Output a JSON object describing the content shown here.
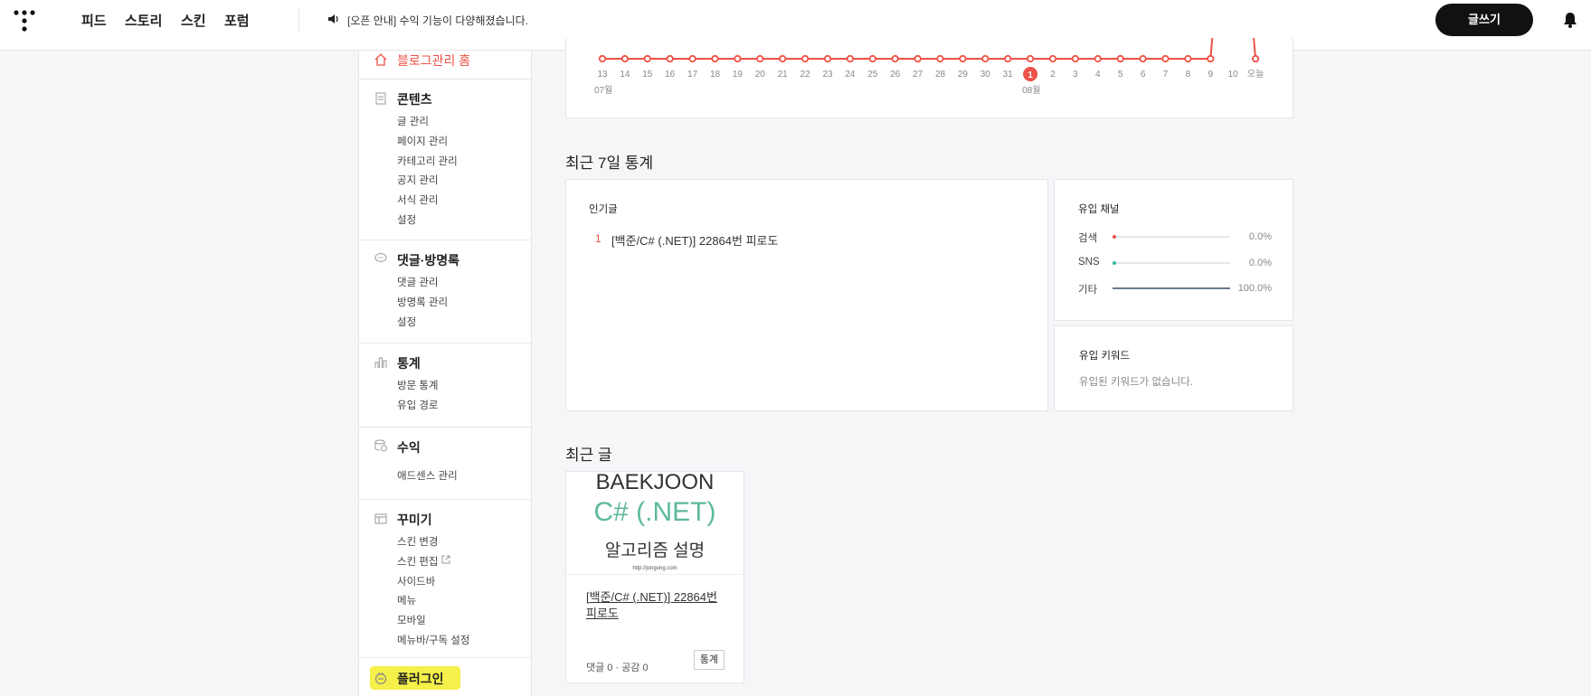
{
  "topnav": {
    "items": [
      "피드",
      "스토리",
      "스킨",
      "포럼"
    ],
    "notice": "[오픈 안내] 수익 기능이 다양해졌습니다.",
    "write_label": "글쓰기"
  },
  "sidebar": {
    "home": "블로그관리 홈",
    "content": {
      "title": "콘텐츠",
      "items": [
        "글 관리",
        "페이지 관리",
        "카테고리 관리",
        "공지 관리",
        "서식 관리",
        "설정"
      ]
    },
    "comments": {
      "title": "댓글·방명록",
      "items": [
        "댓글 관리",
        "방명록 관리",
        "설정"
      ]
    },
    "stats": {
      "title": "통계",
      "items": [
        "방문 통계",
        "유입 경로"
      ]
    },
    "revenue": {
      "title": "수익",
      "items": [
        "애드센스 관리"
      ]
    },
    "decorate": {
      "title": "꾸미기",
      "items": [
        "스킨 변경",
        "스킨 편집",
        "사이드바",
        "메뉴",
        "모바일",
        "메뉴바/구독 설정"
      ]
    },
    "plugin": "플러그인"
  },
  "chart_data": {
    "type": "line",
    "x": [
      "13",
      "14",
      "15",
      "16",
      "17",
      "18",
      "19",
      "20",
      "21",
      "22",
      "23",
      "24",
      "25",
      "26",
      "27",
      "28",
      "29",
      "30",
      "31",
      "1",
      "2",
      "3",
      "4",
      "5",
      "6",
      "7",
      "8",
      "9",
      "10",
      "오늘"
    ],
    "month_labels": [
      "07월",
      "08월"
    ],
    "highlight": "1",
    "values": [
      0,
      0,
      0,
      0,
      0,
      0,
      0,
      0,
      0,
      0,
      0,
      0,
      0,
      0,
      0,
      0,
      0,
      0,
      0,
      0,
      0,
      0,
      0,
      0,
      0,
      0,
      0,
      0,
      null,
      0
    ],
    "color": "#ef5146"
  },
  "recent7": {
    "title": "최근 7일 통계",
    "popular": {
      "label": "인기글",
      "items": [
        {
          "rank": "1",
          "title": "[백준/C# (.NET)] 22864번 피로도"
        }
      ]
    },
    "channels": {
      "label": "유입 채널",
      "items": [
        {
          "name": "검색",
          "value": "0.0%",
          "fraction": 0.0,
          "dot_color": "#ef5146"
        },
        {
          "name": "SNS",
          "value": "0.0%",
          "fraction": 0.0,
          "dot_color": "#2ebfa0"
        },
        {
          "name": "기타",
          "value": "100.0%",
          "fraction": 1.0,
          "dot_color": "#6b7888"
        }
      ]
    },
    "keywords": {
      "label": "유입 키워드",
      "empty": "유입된 키워드가 없습니다."
    }
  },
  "recent_posts": {
    "title": "최근 글",
    "post": {
      "thumb_lines": [
        "BAEKJOON",
        "C# (.NET)",
        "알고리즘 설명",
        "http://jongung.com"
      ],
      "title": "[백준/C# (.NET)] 22864번 피로도",
      "meta": "댓글 0 · 공감 0",
      "stat_label": "통계"
    }
  }
}
